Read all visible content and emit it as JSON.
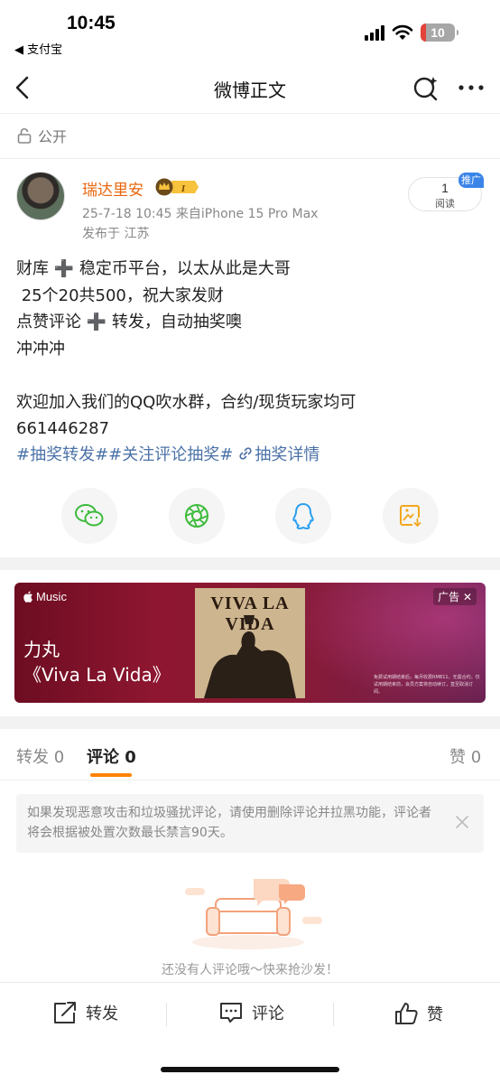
{
  "status_bar": {
    "time": "10:45",
    "back_app": "◀ 支付宝",
    "battery": "10"
  },
  "nav": {
    "title": "微博正文",
    "icons": [
      "back-icon",
      "search-icon",
      "more-icon"
    ]
  },
  "visibility": {
    "label": "公开",
    "icon": "lock-icon"
  },
  "author": {
    "name": "瑞达里安",
    "badge": "vip-crown-badge",
    "meta": "25-7-18 10:45  来自iPhone 15 Pro Max",
    "location": "发布于 江苏",
    "read_count": "1",
    "read_label": "阅读",
    "promo_tag": "推广"
  },
  "post": {
    "lines": [
      "财库 ➕ 稳定币平台，以太从此是大哥",
      " 25个20共500，祝大家发财",
      "点赞评论 ➕ 转发，自动抽奖噢",
      "冲冲冲",
      "",
      "欢迎加入我们的QQ吹水群，合约/现货玩家均可",
      "661446287"
    ],
    "hashtags": "#抽奖转发##关注评论抽奖#",
    "lottery_link": "抽奖详情"
  },
  "share": {
    "icons": [
      "wechat-icon",
      "moments-icon",
      "qq-icon",
      "save-image-icon"
    ]
  },
  "ad": {
    "brand": "Music",
    "artist": "力丸",
    "song": "《Viva La Vida》",
    "cover_title": "VIVA LA VIDA",
    "tag": "广告 ✕",
    "fine_print": "免费试用期结束后，每月收费RMB11，无需合约。仅试用期结束前，会员方案将自动续订，直至取消订阅。"
  },
  "tabs": {
    "repost": "转发",
    "repost_count": "0",
    "comment": "评论",
    "comment_count": "0",
    "like": "赞",
    "like_count": "0",
    "active": "comment"
  },
  "notice": {
    "text": "如果发现恶意攻击和垃圾骚扰评论，请使用删除评论并拉黑功能，评论者将会根据被处置次数最长禁言90天。"
  },
  "empty": {
    "text": "还没有人评论哦～快来抢沙发！"
  },
  "bottom_bar": {
    "repost": "转发",
    "comment": "评论",
    "like": "赞"
  },
  "colors": {
    "accent": "#ff8200",
    "username": "#e8670f",
    "link": "#4b72a8",
    "promo": "#3a84e8",
    "ad_bg": "#8e1630"
  }
}
